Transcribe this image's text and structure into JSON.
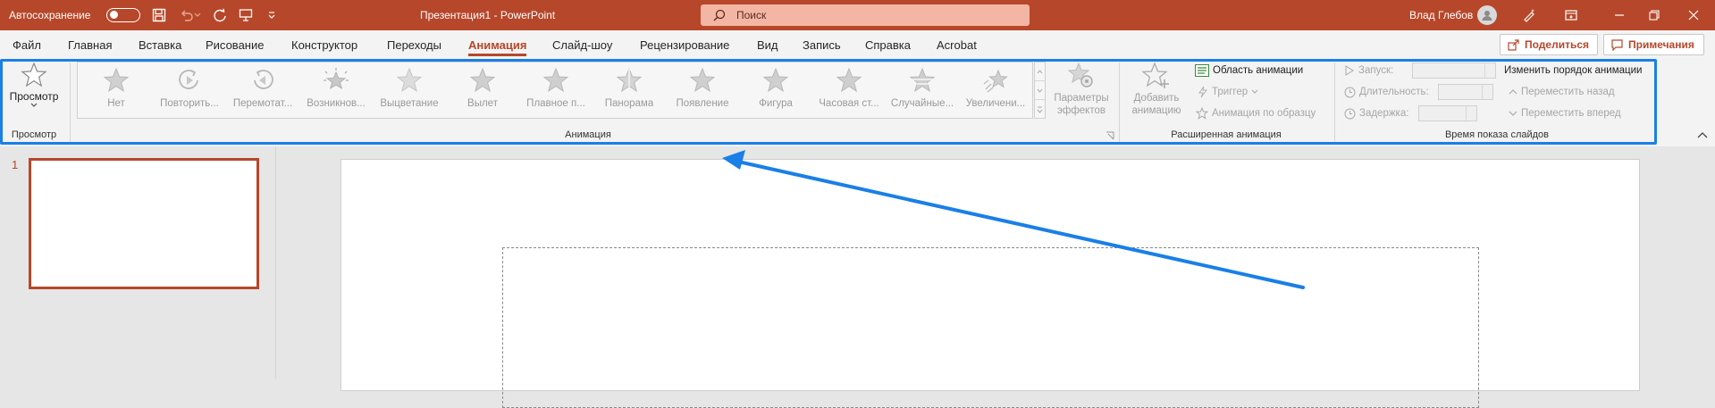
{
  "titlebar": {
    "autosave_label": "Автосохранение",
    "doc_title": "Презентация1  -  PowerPoint",
    "search_placeholder": "Поиск",
    "user_name": "Влад Глебов"
  },
  "tabs": {
    "file": "Файл",
    "home": "Главная",
    "insert": "Вставка",
    "draw": "Рисование",
    "design": "Конструктор",
    "transitions": "Переходы",
    "animations": "Анимация",
    "slideshow": "Слайд-шоу",
    "review": "Рецензирование",
    "view": "Вид",
    "record": "Запись",
    "help": "Справка",
    "acrobat": "Acrobat",
    "active": "Анимация"
  },
  "actions": {
    "share": "Поделиться",
    "notes": "Примечания"
  },
  "ribbon": {
    "preview": {
      "button_label": "Просмотр",
      "group_label": "Просмотр"
    },
    "animation": {
      "group_label": "Анимация",
      "items": [
        {
          "label": "Нет",
          "icon": "star-none-icon"
        },
        {
          "label": "Повторить...",
          "icon": "replay-icon"
        },
        {
          "label": "Перемотат...",
          "icon": "rewind-icon"
        },
        {
          "label": "Возникнов...",
          "icon": "appear-burst-icon"
        },
        {
          "label": "Выцветание",
          "icon": "fade-star-icon"
        },
        {
          "label": "Вылет",
          "icon": "fly-in-star-icon"
        },
        {
          "label": "Плавное п...",
          "icon": "float-in-star-icon"
        },
        {
          "label": "Панорама",
          "icon": "split-star-icon"
        },
        {
          "label": "Появление",
          "icon": "wipe-star-icon"
        },
        {
          "label": "Фигура",
          "icon": "shape-star-icon"
        },
        {
          "label": "Часовая ст...",
          "icon": "wheel-star-icon"
        },
        {
          "label": "Случайные...",
          "icon": "random-bars-star-icon"
        },
        {
          "label": "Увеличени...",
          "icon": "grow-turn-star-icon"
        }
      ],
      "effect_options": "Параметры эффектов"
    },
    "advanced": {
      "group_label": "Расширенная анимация",
      "add_animation": "Добавить анимацию",
      "animation_pane": "Область анимации",
      "trigger": "Триггер",
      "painter": "Анимация по образцу"
    },
    "timing": {
      "group_label": "Время показа слайдов",
      "start": "Запуск:",
      "duration": "Длительность:",
      "delay": "Задержка:",
      "reorder_title": "Изменить порядок анимации",
      "move_earlier": "Переместить назад",
      "move_later": "Переместить вперед"
    }
  },
  "slides": {
    "numbers": [
      "1"
    ]
  },
  "colors": {
    "accent": "#b7472a",
    "highlight": "#1a7fe6"
  }
}
